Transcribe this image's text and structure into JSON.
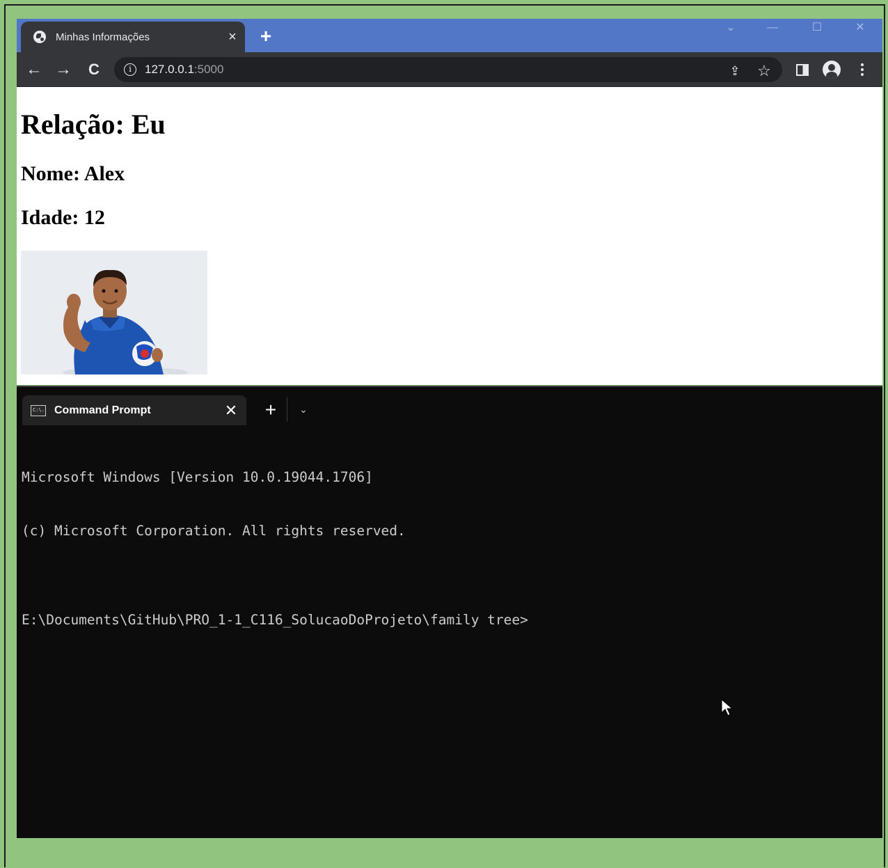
{
  "browser": {
    "tab": {
      "title": "Minhas Informações",
      "close_glyph": "×",
      "icon": "globe-icon"
    },
    "new_tab_glyph": "+",
    "window_controls": {
      "dropdown": "⌄",
      "minimize": "—",
      "maximize": "☐",
      "close": "✕"
    },
    "nav": {
      "back": "←",
      "forward": "→",
      "reload": "C"
    },
    "omnibox": {
      "info_glyph": "i",
      "host": "127.0.0.1",
      "port": ":5000"
    },
    "actions": {
      "share": "⇪",
      "bookmark": "☆"
    }
  },
  "page": {
    "heading": "Relação: Eu",
    "name_line": "Nome: Alex",
    "age_line": "Idade: 12",
    "photo_icon": "child-photo"
  },
  "terminal": {
    "tab": {
      "title": "Command Prompt",
      "icon_text": "C:\\.",
      "close_glyph": "✕"
    },
    "new_tab_glyph": "+",
    "dropdown_glyph": "⌄",
    "lines": [
      "Microsoft Windows [Version 10.0.19044.1706]",
      "(c) Microsoft Corporation. All rights reserved.",
      "",
      "E:\\Documents\\GitHub\\PRO_1-1_C116_SolucaoDoProjeto\\family tree>"
    ]
  },
  "colors": {
    "frame_green": "#91c47f",
    "browser_tabstrip": "#5277c6",
    "browser_toolbar": "#35363a",
    "terminal_bg": "#0c0c0c"
  }
}
